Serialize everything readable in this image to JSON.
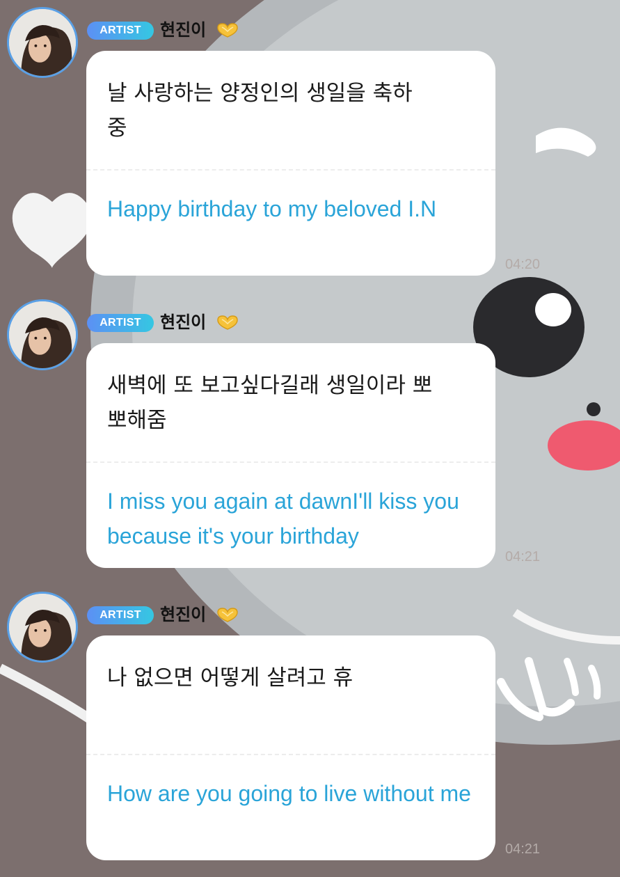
{
  "messages": [
    {
      "badge": "ARTIST",
      "username": "현진이",
      "original": "날 사랑하는 양정인의 생일을 축하\n중",
      "translation": "Happy birthday to my beloved I.N",
      "time": "04:20"
    },
    {
      "badge": "ARTIST",
      "username": "현진이",
      "original": "새벽에 또 보고싶다길래 생일이라 뽀\n뽀해줌",
      "translation": "I miss you again at dawnI'll kiss you because it's your birthday",
      "time": "04:21"
    },
    {
      "badge": "ARTIST",
      "username": "현진이",
      "original": "나 없으면 어떻게 살려고 휴",
      "translation": "How are you going to live without me",
      "time": "04:21"
    }
  ],
  "icons": {
    "name_suffix": "heart-hands-icon",
    "avatar": "profile-photo"
  },
  "colors": {
    "background": "#7c6f6e",
    "bubble": "#ffffff",
    "translation_text": "#2aa4d8",
    "badge_gradient_start": "#5c90f4",
    "badge_gradient_end": "#35c7e2",
    "avatar_ring": "#5aa0e6",
    "timestamp": "#b4aba8"
  }
}
